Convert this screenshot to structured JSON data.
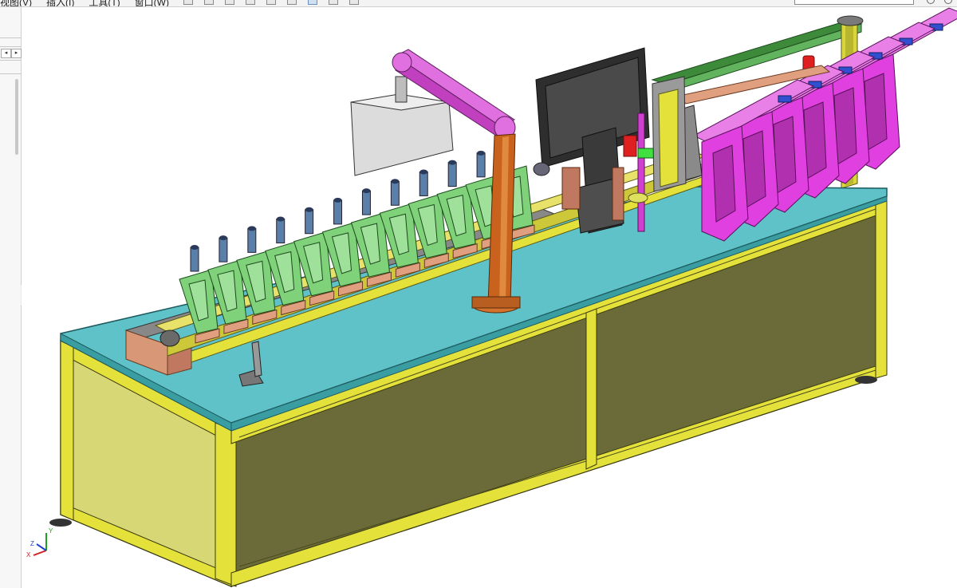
{
  "menu": {
    "items": [
      "视图(V)",
      "插入(I)",
      "工具(T)",
      "窗口(W)"
    ]
  },
  "toolbar": {
    "icons": [
      "new-icon",
      "open-icon",
      "save-icon",
      "print-icon",
      "undo-icon",
      "redo-icon",
      "select-icon",
      "rebuild-icon",
      "options-icon"
    ],
    "status_text": "",
    "search_placeholder": ""
  },
  "heads_up_toolbar": {
    "icons": [
      "zoom-to-fit-icon",
      "zoom-to-area-icon",
      "previous-view-icon",
      "section-view-icon",
      "view-orientation-icon",
      "display-style-icon",
      "hide-show-items-icon",
      "edit-appearance-icon",
      "apply-scene-icon",
      "view-settings-icon"
    ]
  },
  "left_panel": {
    "arrow_left": "◂",
    "arrow_right": "▸"
  },
  "triad": {
    "x_label": "X",
    "y_label": "Y",
    "z_label": "Z"
  },
  "colors": {
    "cabinet_panel": "#6b6b3a",
    "cabinet_frame": "#e4e23a",
    "tabletop": "#5fc2c8",
    "bracket": "#7fd17a",
    "magenta_parts": "#e040e0",
    "column": "#c8621c",
    "monitor": "#3a3a3a",
    "cylinders": "#5a7fa8",
    "tray": "#e0a080"
  }
}
